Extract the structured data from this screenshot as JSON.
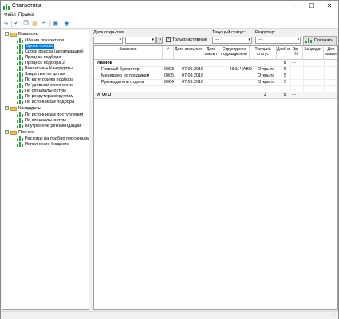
{
  "window": {
    "title": "Статистика",
    "minimize": "–",
    "maximize": "☐",
    "close": "✕"
  },
  "menu": [
    "Файл",
    "Правка"
  ],
  "tree": {
    "groups": [
      {
        "label": "Вакансии",
        "items": [
          "Общие показатели",
          "Сроки поиска",
          "Сроки поиска (детализация)",
          "Процесс подбора",
          "Процесс подбора 2",
          "Вакансии + Кандидаты",
          "Закрытые по датам",
          "По категориям подбора",
          "По уровням сложности",
          "По специальностям",
          "По рекрутерам/группам",
          "По источникам подбора"
        ]
      },
      {
        "label": "Кандидаты",
        "items": [
          "По источникам поступления",
          "По специальностям",
          "Внутренние рекомендации"
        ]
      },
      {
        "label": "Прочее",
        "items": [
          "Расходы на подбор персонала",
          "Исполнение бюджета"
        ]
      }
    ],
    "selected": "Сроки поиска"
  },
  "filters": {
    "date_label": "Дата открытия:",
    "date_from": "",
    "date_to": "",
    "only_active_label": "Только активные",
    "only_active_checked": true,
    "status_label": "Текущий статус:",
    "status_value": "---",
    "recruiter_label": "Рекрутер:",
    "recruiter_value": "---",
    "show_button": "Показать"
  },
  "grid": {
    "columns": [
      "Вакансия",
      "#",
      "Дата открытия",
      "Дата закрыт",
      "Структурное подразделени",
      "Текущий статус",
      "Дней в",
      "Эр - %",
      "Кандидат",
      "Доп вакан"
    ],
    "group_row": {
      "name": "Иванов",
      "days": "5",
      "pct": "- -"
    },
    "rows": [
      {
        "vacancy": "Главный бухгалтер",
        "num": "0003",
        "opened": "07.09.2016",
        "closed": "",
        "dept": "НИИ ЧАВО",
        "status": "Открыта",
        "days": "5"
      },
      {
        "vacancy": "Менеджер по продажам",
        "num": "0005",
        "opened": "07.09.2016",
        "closed": "",
        "dept": "",
        "status": "Открыта",
        "days": "5"
      },
      {
        "vacancy": "Руководитель отдела",
        "num": "0004",
        "opened": "07.09.2016",
        "closed": "",
        "dept": "",
        "status": "Открыта",
        "days": "5"
      }
    ],
    "total_row": {
      "label": "ИТОГО",
      "count": "3",
      "days": "5",
      "pct": "- -"
    }
  }
}
